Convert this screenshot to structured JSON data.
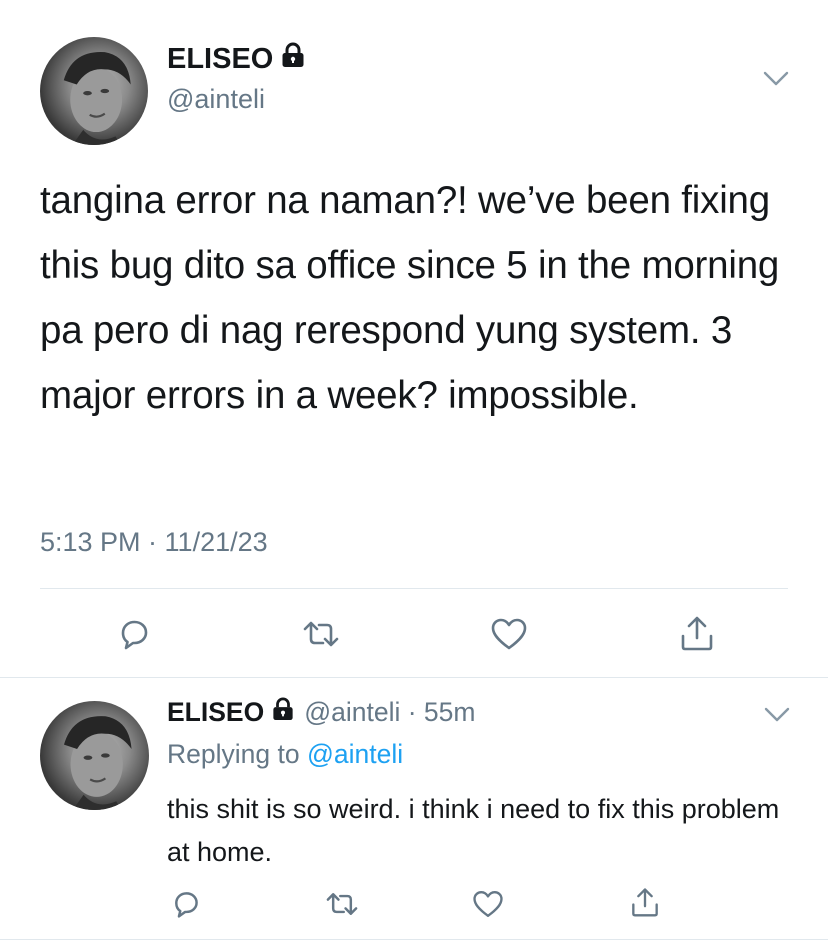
{
  "main_tweet": {
    "display_name": "ELISEO",
    "handle": "@ainteli",
    "text": "tangina error na naman?! we’ve been fixing this bug dito sa office since 5 in the morning pa pero di nag rerespond yung system. 3 major errors in a week? impossible.",
    "timestamp": "5:13 PM · 11/21/23"
  },
  "reply_tweet": {
    "display_name": "ELISEO",
    "handle_time": "@ainteli · 55m",
    "replying_prefix": "Replying to",
    "replying_to": "@ainteli",
    "text": "this shit is so weird. i think i need to fix this problem at home."
  },
  "icons": {
    "lock": "lock-icon",
    "chevron": "chevron-down-icon",
    "reply": "reply-icon",
    "retweet": "retweet-icon",
    "like": "heart-icon",
    "share": "share-icon"
  },
  "colors": {
    "text": "#14171a",
    "secondary": "#657786",
    "link": "#1da1f2",
    "divider": "#e1e8ed",
    "icon": "#657786"
  }
}
